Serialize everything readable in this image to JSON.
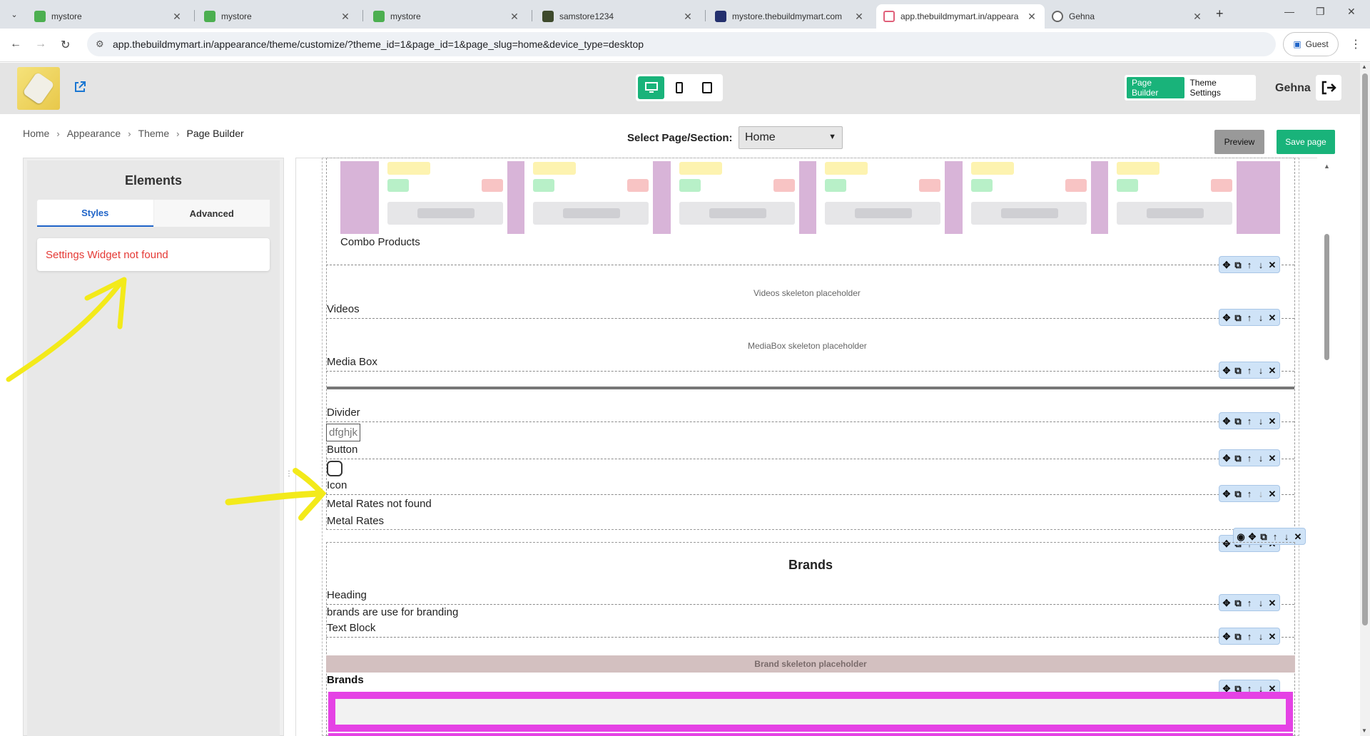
{
  "browser": {
    "tabs": [
      {
        "title": "mystore",
        "favicon": "green-store"
      },
      {
        "title": "mystore",
        "favicon": "green-store"
      },
      {
        "title": "mystore",
        "favicon": "green-store"
      },
      {
        "title": "samstore1234",
        "favicon": "dark-store"
      },
      {
        "title": "mystore.thebuildmymart.com",
        "favicon": "navy-site"
      },
      {
        "title": "app.thebuildmymart.in/appeara",
        "favicon": "pink-site"
      },
      {
        "title": "Gehna",
        "favicon": "globe"
      }
    ],
    "url": "app.thebuildmymart.in/appearance/theme/customize/?theme_id=1&page_id=1&page_slug=home&device_type=desktop",
    "profile_label": "Guest"
  },
  "header": {
    "mode_buttons": [
      "Page Builder",
      "Theme Settings"
    ],
    "username": "Gehna",
    "accent_color": "#19b37a"
  },
  "breadcrumb": [
    "Home",
    "Appearance",
    "Theme",
    "Page Builder"
  ],
  "toolbar": {
    "select_label": "Select Page/Section:",
    "selected_page": "Home",
    "preview_label": "Preview",
    "save_label": "Save page"
  },
  "elements_panel": {
    "title": "Elements",
    "tabs": [
      "Styles",
      "Advanced"
    ],
    "message": "Settings Widget not found"
  },
  "canvas": {
    "combo_label": "Combo Products",
    "videos_placeholder": "Videos skeleton placeholder",
    "videos_label": "Videos",
    "mediabox_placeholder": "MediaBox skeleton placeholder",
    "mediabox_label": "Media Box",
    "divider_label": "Divider",
    "button_text": "dfghjk",
    "button_label": "Button",
    "icon_label": "Icon",
    "metal_rates_message": "Metal Rates not found",
    "metal_rates_label": "Metal Rates",
    "brands_heading": "Brands",
    "heading_label": "Heading",
    "brands_text": "brands are use for branding",
    "text_block_label": "Text Block",
    "brand_placeholder": "Brand skeleton placeholder",
    "brands_label": "Brands"
  }
}
